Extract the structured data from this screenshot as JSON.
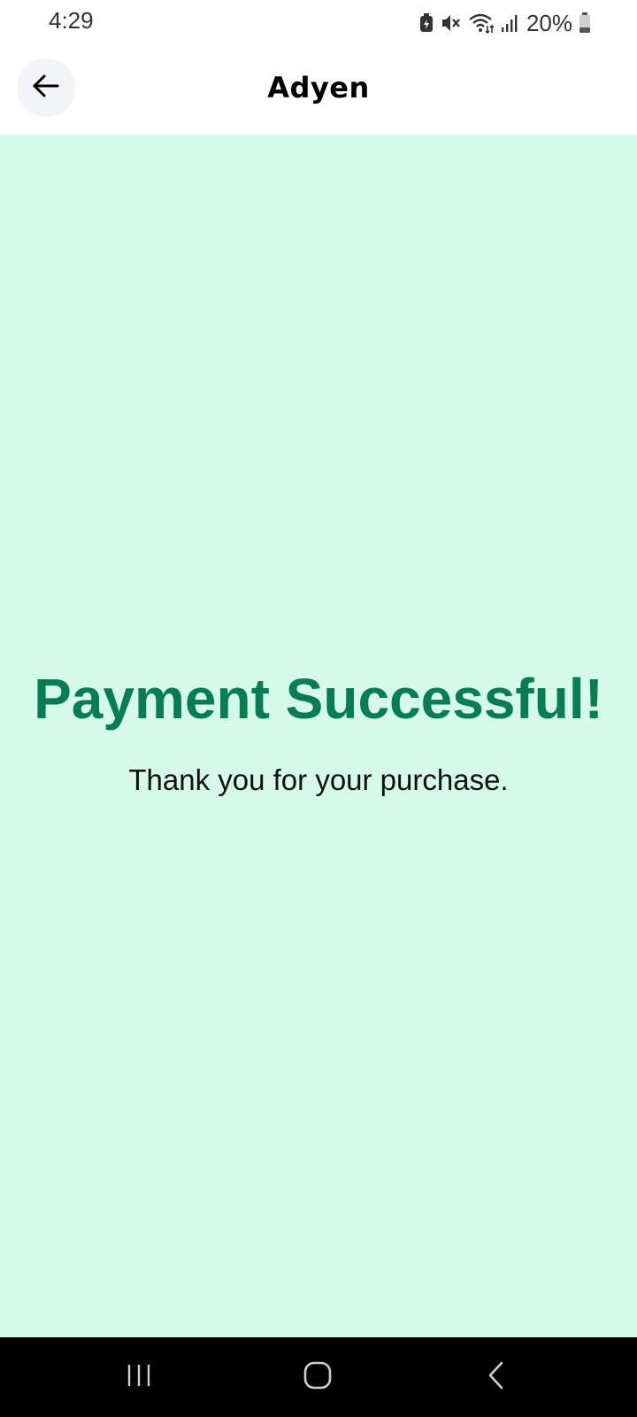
{
  "status_bar": {
    "time": "4:29",
    "battery_percent": "20%",
    "icons": [
      "data-saver-icon",
      "mute-icon",
      "wifi-icon",
      "signal-icon",
      "battery-icon"
    ]
  },
  "app_bar": {
    "title": "Adyen",
    "back_icon": "arrow-left-icon"
  },
  "content": {
    "title": "Payment Successful!",
    "subtitle": "Thank you for your purchase.",
    "background_color": "#d5fae9",
    "title_color": "#087d55"
  },
  "nav_bar": {
    "buttons": [
      "recent-apps-icon",
      "home-icon",
      "back-icon"
    ]
  }
}
